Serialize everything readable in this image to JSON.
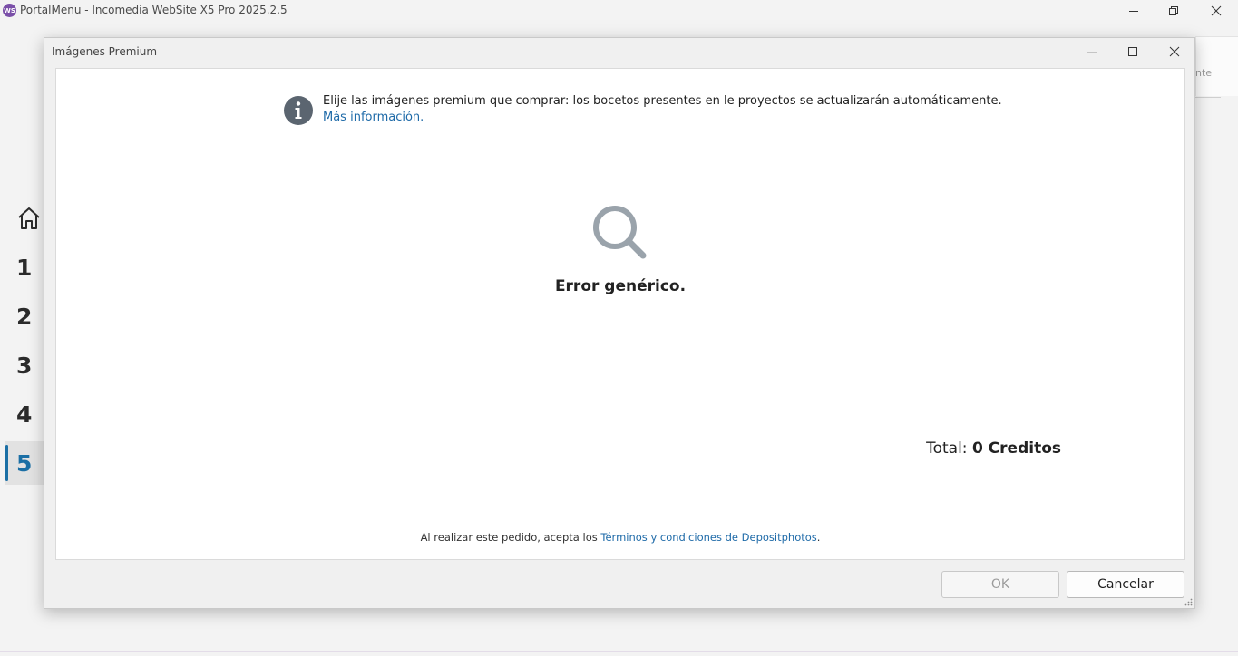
{
  "app": {
    "logo_text": "WS",
    "title": "PortalMenu - Incomedia WebSite X5 Pro 2025.2.5"
  },
  "sidebar": {
    "steps": [
      {
        "label": "1"
      },
      {
        "label": "2"
      },
      {
        "label": "3"
      },
      {
        "label": "4"
      },
      {
        "label": "5",
        "active": true
      }
    ]
  },
  "background_panel": {
    "partial_text": "nte"
  },
  "dialog": {
    "title": "Imágenes Premium",
    "info_text": "Elije las imágenes premium que comprar: los bocetos presentes en le proyectos se actualizarán automáticamente.",
    "info_link": "Más información.",
    "error_text": "Error genérico.",
    "total_label": "Total:",
    "total_value": "0 Creditos",
    "terms_prefix": "Al realizar este pedido, acepta los ",
    "terms_link": "Términos y condiciones de Depositphotos",
    "terms_suffix": ".",
    "ok_label": "OK",
    "cancel_label": "Cancelar"
  },
  "colors": {
    "accent": "#1b6fa5",
    "link": "#1e6aa8",
    "info_icon": "#5b6570",
    "search_icon": "#9aa3ab"
  },
  "icons": [
    "app-logo-icon",
    "minimize-icon",
    "restore-icon",
    "close-icon",
    "maximize-icon",
    "home-icon",
    "info-icon",
    "search-icon",
    "resize-grip-icon"
  ]
}
